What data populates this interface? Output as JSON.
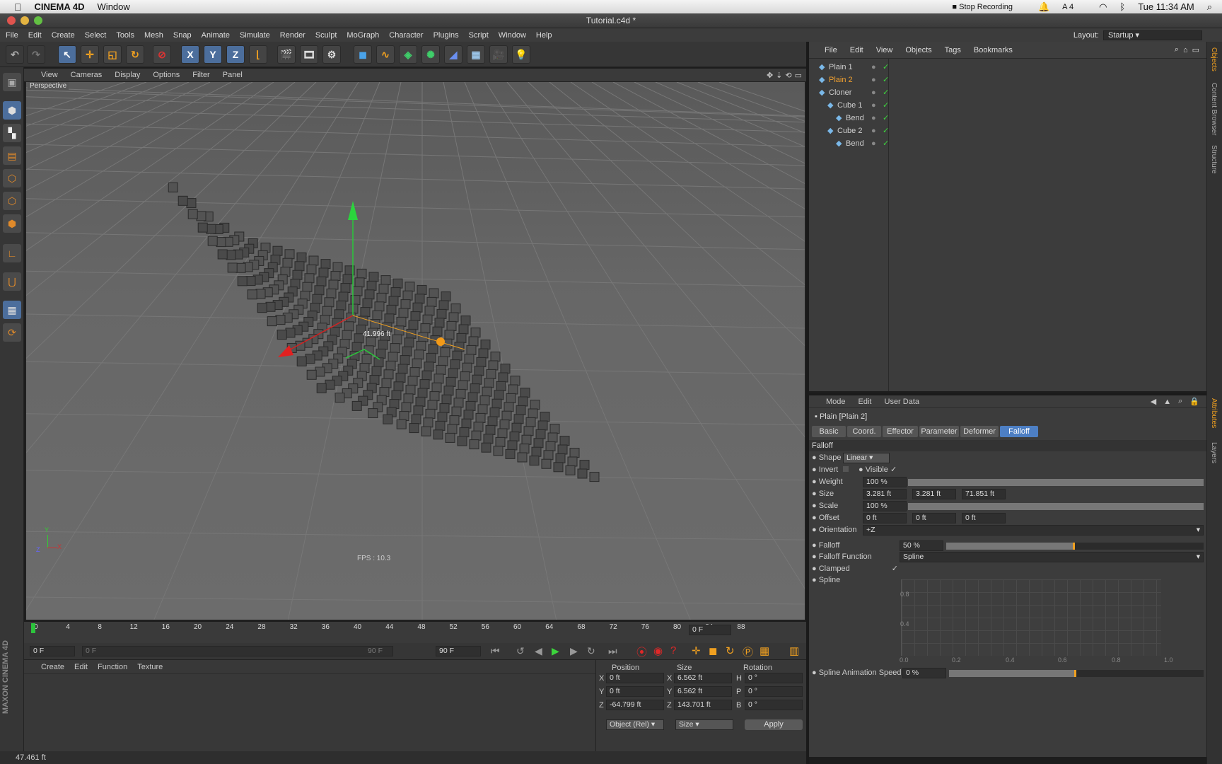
{
  "mac_menubar": {
    "app": "CINEMA 4D",
    "window_menu": "Window",
    "status_items": [
      "Stop Recording",
      "4"
    ],
    "clock": "Tue 11:34 AM"
  },
  "window_title": "Tutorial.c4d *",
  "main_menu": [
    "File",
    "Edit",
    "Create",
    "Select",
    "Tools",
    "Mesh",
    "Snap",
    "Animate",
    "Simulate",
    "Render",
    "Sculpt",
    "MoGraph",
    "Character",
    "Plugins",
    "Script",
    "Window",
    "Help"
  ],
  "layout": {
    "label": "Layout:",
    "value": "Startup"
  },
  "toolbar": {
    "axis_x": "X",
    "axis_y": "Y",
    "axis_z": "Z"
  },
  "viewport_menu": [
    "View",
    "Cameras",
    "Display",
    "Options",
    "Filter",
    "Panel"
  ],
  "viewport": {
    "label": "Perspective",
    "measure": "41.996 ft",
    "fps": "FPS : 10.3",
    "axis_y": "Y",
    "axis_x": "X",
    "axis_z": "Z"
  },
  "timeline": {
    "ticks": [
      "0",
      "4",
      "8",
      "12",
      "16",
      "20",
      "24",
      "28",
      "32",
      "36",
      "40",
      "44",
      "48",
      "52",
      "56",
      "60",
      "64",
      "68",
      "72",
      "76",
      "80",
      "84",
      "88"
    ],
    "current_frame": "0 F"
  },
  "transport": {
    "start": "0 F",
    "range_start": "0 F",
    "range_end": "90 F",
    "end": "90 F"
  },
  "material_menu": [
    "Create",
    "Edit",
    "Function",
    "Texture"
  ],
  "coords": {
    "headers": [
      "Position",
      "Size",
      "Rotation"
    ],
    "rows": [
      {
        "axis": "X",
        "pos": "0 ft",
        "saxis": "X",
        "size": "6.562 ft",
        "raxis": "H",
        "rot": "0 °"
      },
      {
        "axis": "Y",
        "pos": "0 ft",
        "saxis": "Y",
        "size": "6.562 ft",
        "raxis": "P",
        "rot": "0 °"
      },
      {
        "axis": "Z",
        "pos": "-64.799 ft",
        "saxis": "Z",
        "size": "143.701 ft",
        "raxis": "B",
        "rot": "0 °"
      }
    ],
    "mode1": "Object (Rel)",
    "mode2": "Size",
    "apply": "Apply"
  },
  "status_text": "47.461 ft",
  "brand": "MAXON CINEMA 4D",
  "object_manager": {
    "menu": [
      "File",
      "Edit",
      "View",
      "Objects",
      "Tags",
      "Bookmarks"
    ],
    "objects": [
      {
        "name": "Plain 1",
        "indent": 0,
        "color": "#cfcfcf"
      },
      {
        "name": "Plain 2",
        "indent": 0,
        "color": "#f0a030"
      },
      {
        "name": "Cloner",
        "indent": 0,
        "color": "#cfcfcf"
      },
      {
        "name": "Cube 1",
        "indent": 1,
        "color": "#cfcfcf"
      },
      {
        "name": "Bend",
        "indent": 2,
        "color": "#cfcfcf"
      },
      {
        "name": "Cube 2",
        "indent": 1,
        "color": "#cfcfcf"
      },
      {
        "name": "Bend",
        "indent": 2,
        "color": "#cfcfcf"
      }
    ]
  },
  "attributes": {
    "menu": [
      "Mode",
      "Edit",
      "User Data"
    ],
    "object": "Plain [Plain 2]",
    "tabs": [
      "Basic",
      "Coord.",
      "Effector",
      "Parameter",
      "Deformer",
      "Falloff"
    ],
    "active_tab": "Falloff",
    "section": "Falloff",
    "shape_label": "Shape",
    "shape": "Linear",
    "invert_label": "Invert",
    "visible_label": "Visible",
    "visible_check": "✓",
    "weight_label": "Weight",
    "weight": "100 %",
    "size_label": "Size",
    "size": [
      "3.281 ft",
      "3.281 ft",
      "71.851 ft"
    ],
    "scale_label": "Scale",
    "scale": "100 %",
    "offset_label": "Offset",
    "offset": [
      "0 ft",
      "0 ft",
      "0 ft"
    ],
    "orientation_label": "Orientation",
    "orientation": "+Z",
    "falloff_label": "Falloff",
    "falloff": "50 %",
    "falloff_level": 0.5,
    "falloff_fn_label": "Falloff Function",
    "falloff_fn": "Spline",
    "clamped_label": "Clamped",
    "clamped_check": "✓",
    "spline_label": "Spline",
    "spline_y_ticks": [
      "0.8",
      "0.4"
    ],
    "spline_x_ticks": [
      "0.0",
      "0.2",
      "0.4",
      "0.6",
      "0.8",
      "1.0"
    ],
    "spline_speed_label": "Spline Animation Speed",
    "spline_speed": "0 %"
  },
  "side_tabs": [
    "Objects",
    "Content Browser",
    "Structure",
    "Attributes",
    "Layers"
  ]
}
